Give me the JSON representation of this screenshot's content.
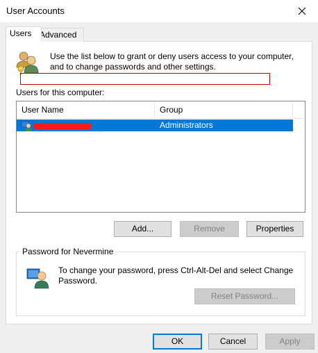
{
  "window": {
    "title": "User Accounts"
  },
  "tabs": [
    {
      "label": "Users",
      "active": true
    },
    {
      "label": "Advanced",
      "active": false
    }
  ],
  "users_tab": {
    "intro_text": "Use the list below to grant or deny users access to your computer, and to change passwords and other settings.",
    "users_label": "Users for this computer:",
    "columns": [
      "User Name",
      "Group"
    ],
    "rows": [
      {
        "user_name": "",
        "group": "Administrators",
        "selected": true
      }
    ],
    "buttons": {
      "add": "Add...",
      "remove": "Remove",
      "properties": "Properties"
    },
    "password_group": {
      "title": "Password for Nevermine",
      "text": "To change your password, press Ctrl-Alt-Del and select Change Password.",
      "reset_button": "Reset Password..."
    }
  },
  "dialog_buttons": {
    "ok": "OK",
    "cancel": "Cancel",
    "apply": "Apply"
  },
  "colors": {
    "selection": "#0078d7",
    "redaction": "#ff1a1a",
    "annotation_box": "#c00000"
  },
  "icons": [
    "close-icon",
    "users-icon",
    "user-row-icon",
    "password-user-icon"
  ]
}
